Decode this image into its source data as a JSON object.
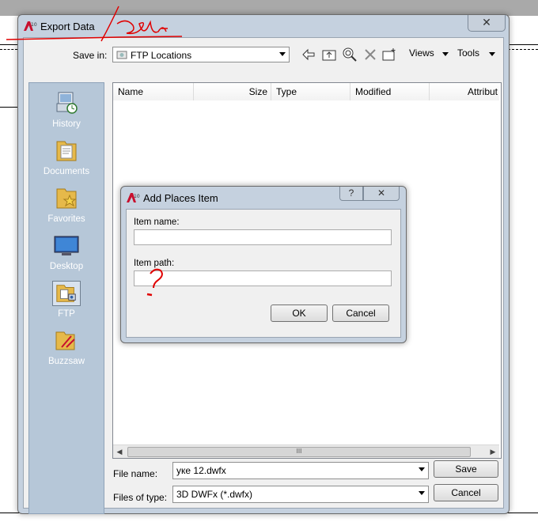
{
  "window": {
    "title": "Export Data",
    "close_glyph": "✕"
  },
  "toolbar": {
    "save_in_label": "Save in:",
    "location_value": "FTP Locations",
    "views_label": "Views",
    "tools_label": "Tools",
    "icons": [
      "back-icon",
      "up-folder-icon",
      "search-web-icon",
      "delete-icon",
      "new-folder-icon"
    ]
  },
  "places": [
    {
      "label": "History",
      "icon": "history-icon"
    },
    {
      "label": "Documents",
      "icon": "documents-folder-icon"
    },
    {
      "label": "Favorites",
      "icon": "favorites-folder-icon"
    },
    {
      "label": "Desktop",
      "icon": "desktop-icon"
    },
    {
      "label": "FTP",
      "icon": "ftp-icon",
      "selected": true
    },
    {
      "label": "Buzzsaw",
      "icon": "buzzsaw-icon"
    }
  ],
  "filelist": {
    "columns": [
      "Name",
      "Size",
      "Type",
      "Modified",
      "Attribut"
    ],
    "scroll_grip": "III"
  },
  "bottom": {
    "filename_label": "File name:",
    "filename_value": "уке 12.dwfx",
    "filetype_label": "Files of type:",
    "filetype_value": "3D DWFx (*.dwfx)",
    "save_button": "Save",
    "cancel_button": "Cancel"
  },
  "dialog": {
    "title": "Add Places Item",
    "help_glyph": "?",
    "close_glyph": "✕",
    "item_name_label": "Item name:",
    "item_name_value": "",
    "item_path_label": "Item path:",
    "item_path_value": "",
    "ok_button": "OK",
    "cancel_button": "Cancel"
  },
  "colors": {
    "annotation": "#e00000",
    "places_bar": "#b6c7d8",
    "window_frame": "#c5d1df"
  }
}
